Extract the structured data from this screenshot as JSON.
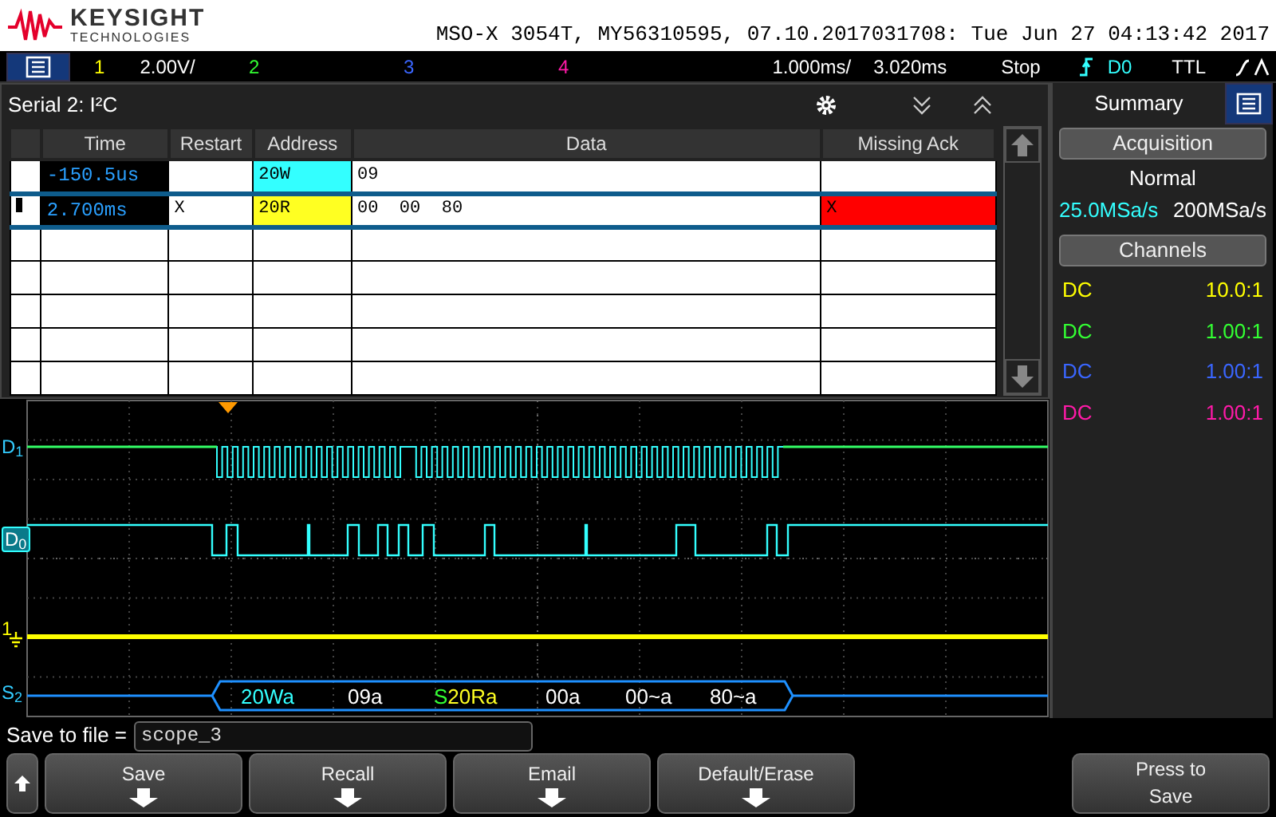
{
  "header": {
    "brand": "KEYSIGHT",
    "brand_sub": "TECHNOLOGIES",
    "title": "MSO-X 3054T, MY56310595, 07.10.2017031708: Tue Jun 27 04:13:42 2017"
  },
  "top_bar": {
    "channels": [
      {
        "label": "1",
        "color": "#ffff00",
        "scale": "2.00V/"
      },
      {
        "label": "2",
        "color": "#33ff33"
      },
      {
        "label": "3",
        "color": "#3a66ff"
      },
      {
        "label": "4",
        "color": "#ff1aa8"
      }
    ],
    "timebase": "1.000ms/",
    "delay": "3.020ms",
    "run_state": "Stop",
    "trigger_source": "D0",
    "trigger_level": "TTL"
  },
  "decode_panel": {
    "title": "Serial 2: I²C",
    "columns": [
      "Time",
      "Restart",
      "Address",
      "Data",
      "Missing Ack"
    ],
    "rows": [
      {
        "selected": false,
        "time": "-150.5us",
        "address": "20W",
        "color": "#33ffff",
        "data": "09"
      },
      {
        "selected": true,
        "time": "2.700ms",
        "restart": "X",
        "address": "20R",
        "color": "#ffff22",
        "data": "00  00  80",
        "missing_ack": "X"
      }
    ]
  },
  "waveform": {
    "labels": [
      {
        "kind": "digital",
        "text": "D$_{1}$",
        "selected": false
      },
      {
        "kind": "digital",
        "text": "D$_{0}$",
        "selected": true
      },
      {
        "kind": "analog",
        "text": "1"
      },
      {
        "kind": "serial",
        "text": "S$_{2}$"
      }
    ],
    "bus_packets": [
      {
        "text": "20Wa",
        "color": "#33ffff"
      },
      {
        "text": "09a",
        "color": "#ffffff"
      },
      {
        "restart": "S",
        "text": "20Ra",
        "color": "#ffff22"
      },
      {
        "text": "00a",
        "color": "#ffffff"
      },
      {
        "text": "00~a",
        "color": "#ffffff"
      },
      {
        "text": "80~a",
        "color": "#ffffff"
      }
    ]
  },
  "sidebar": {
    "tab": "Summary",
    "sections": [
      {
        "title": "Acquisition",
        "mode": "Normal",
        "rates": [
          {
            "text": "25.0MSa/s",
            "color": "#33ffff"
          },
          {
            "text": "200MSa/s",
            "color": "#ffffff"
          }
        ]
      },
      {
        "title": "Channels",
        "channels": [
          {
            "coupling": "DC",
            "probe": "10.0:1",
            "color": "#ffff00"
          },
          {
            "coupling": "DC",
            "probe": "1.00:1",
            "color": "#33ff33"
          },
          {
            "coupling": "DC",
            "probe": "1.00:1",
            "color": "#3a66ff"
          },
          {
            "coupling": "DC",
            "probe": "1.00:1",
            "color": "#ff1aa8"
          }
        ]
      }
    ]
  },
  "save_field": {
    "label": "Save to file =",
    "value": "scope_3"
  },
  "softkeys": [
    {
      "kind": "up"
    },
    {
      "kind": "menu",
      "label": "Save"
    },
    {
      "kind": "menu",
      "label": "Recall"
    },
    {
      "kind": "menu",
      "label": "Email"
    },
    {
      "kind": "menu",
      "label": "Default/Erase"
    },
    {
      "kind": "blank"
    },
    {
      "kind": "press",
      "label": "Press to Save"
    }
  ]
}
